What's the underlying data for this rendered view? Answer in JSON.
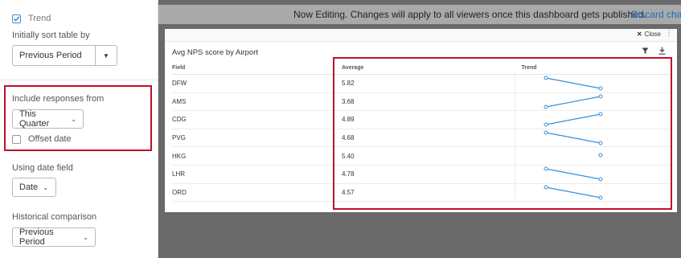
{
  "left_panel": {
    "trend_checkbox": {
      "label": "Trend",
      "checked": true
    },
    "sort_label": "Initially sort table by",
    "sort_value": "Previous Period",
    "include_label": "Include responses from",
    "include_value": "This Quarter",
    "offset_label": "Offset date",
    "offset_checked": false,
    "date_field_label": "Using date field",
    "date_field_value": "Date",
    "historical_label": "Historical comparison",
    "historical_value": "Previous Period"
  },
  "topbar": {
    "message": "Now Editing. Changes will apply to all viewers once this dashboard gets published.",
    "discard_label": "Discard cha"
  },
  "widget": {
    "close_label": "Close",
    "title": "Avg NPS score by Airport",
    "columns": [
      "Field",
      "Average",
      "Trend"
    ],
    "rows": [
      {
        "field": "DFW",
        "average": "5.82",
        "trend": "down"
      },
      {
        "field": "AMS",
        "average": "3.68",
        "trend": "up"
      },
      {
        "field": "CDG",
        "average": "4.89",
        "trend": "up"
      },
      {
        "field": "PVG",
        "average": "4.68",
        "trend": "down"
      },
      {
        "field": "HKG",
        "average": "5.40",
        "trend": "single"
      },
      {
        "field": "LHR",
        "average": "4.78",
        "trend": "down"
      },
      {
        "field": "ORD",
        "average": "4.57",
        "trend": "down"
      }
    ]
  },
  "colors": {
    "accent_red": "#c0102a",
    "trend_line": "#3a8fd6",
    "link": "#1a6fbf"
  },
  "icons": [
    "checkbox-checked-icon",
    "chevron-down-icon",
    "close-icon",
    "kebab-menu-icon",
    "filter-icon",
    "download-icon"
  ]
}
